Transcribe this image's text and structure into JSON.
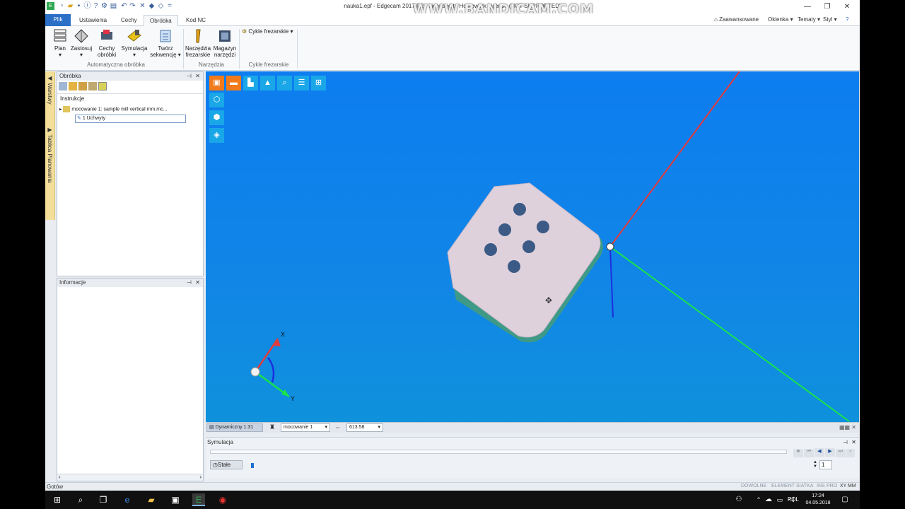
{
  "titlebar": {
    "title": "nauka1.epf - Edge...(NOT SUPPORTED)",
    "title_full": "nauka1.epf - Edgecam 2017 R2 - Licensed to Homework License (NOT SUPPORTED)",
    "watermark": "WWW.BANDICAM.COM"
  },
  "window_controls": {
    "minimize": "—",
    "maximize": "❐",
    "close": "✕"
  },
  "tabs": [
    {
      "label": "Plik"
    },
    {
      "label": "Ustawienia"
    },
    {
      "label": "Cechy"
    },
    {
      "label": "Obróbka"
    },
    {
      "label": "Kod NC"
    }
  ],
  "ribbon_options": {
    "advanced": "Zaawansowane",
    "windows": "Okienka",
    "themes": "Tematy",
    "style": "Styl"
  },
  "ribbon": {
    "plan": "Plan",
    "apply": "Zastosuj",
    "features_line1": "Cechy",
    "features_line2": "obróbki",
    "simulation": "Symulacja",
    "create_line1": "Twórz",
    "create_line2": "sekwencję",
    "tools_line1": "Narzędzia",
    "tools_line2": "frezarskie",
    "magazine_line1": "Magazyn",
    "magazine_line2": "narzędzi",
    "cycles": "Cykle frezarskie",
    "group_auto": "Automatyczna obróbka",
    "group_tools": "Narzędzia",
    "group_cycles": "Cykle frezarskie"
  },
  "side_strip": {
    "layers": "Warstwy",
    "plan_table": "Tablica Planowania"
  },
  "obrobka_panel": {
    "title": "Obróbka",
    "section": "Instrukcje",
    "tree_root": "mocowanie 1: sample mill vertical mm.mc...",
    "tree_child": "1 Uchwyty"
  },
  "info_panel": {
    "title": "Informacje"
  },
  "viewport": {
    "axis_x": "X",
    "axis_y": "Y"
  },
  "view_status": {
    "mode": "Dynamiczny 1:31",
    "fixture": "mocowanie 1",
    "value": "613.58"
  },
  "simulation": {
    "title": "Symulacja",
    "stale_label": "Stałe",
    "spin_value": "1"
  },
  "statusbar": {
    "ready": "Gotów",
    "items": [
      "DOWOLNE",
      "ELEMENT",
      "SIATKA",
      "INS",
      "PRO",
      "XY",
      "MM"
    ]
  },
  "taskbar": {
    "lang": "POL",
    "time": "17:24",
    "date": "04.05.2018"
  }
}
